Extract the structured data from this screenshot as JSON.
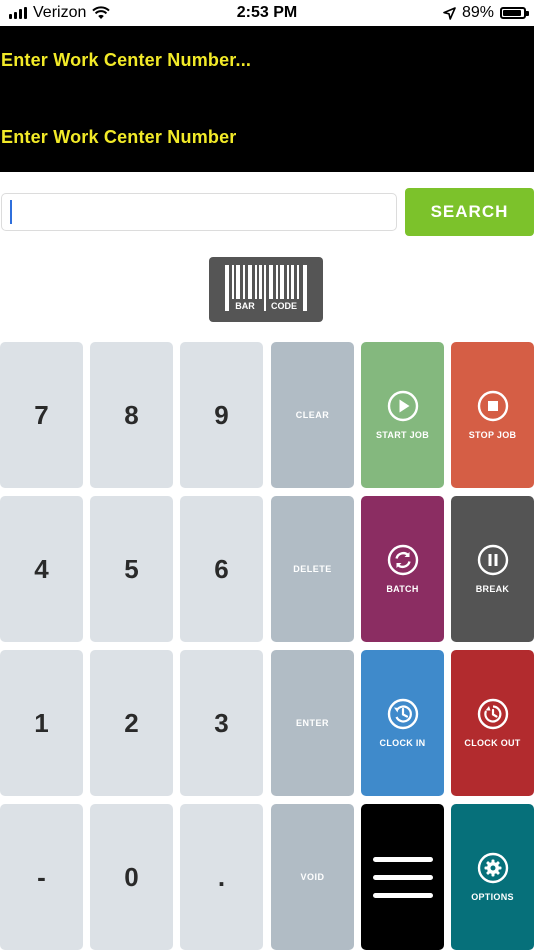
{
  "status_bar": {
    "carrier": "Verizon",
    "time": "2:53 PM",
    "battery_percent": "89%",
    "battery_level": 0.89
  },
  "header": {
    "line1": "Enter Work Center Number...",
    "line2": "Enter Work Center Number",
    "text_color": "#f2ea28",
    "background": "#000000"
  },
  "search": {
    "value": "",
    "button_label": "SEARCH",
    "button_color": "#7cc22b"
  },
  "barcode": {
    "label_left": "BAR",
    "label_right": "CODE"
  },
  "keypad": {
    "numbers": {
      "k7": "7",
      "k8": "8",
      "k9": "9",
      "k4": "4",
      "k5": "5",
      "k6": "6",
      "k1": "1",
      "k2": "2",
      "k3": "3",
      "kminus": "-",
      "k0": "0",
      "kdot": "."
    },
    "controls": {
      "clear": "CLEAR",
      "delete": "DELETE",
      "enter": "ENTER",
      "void": "VOID"
    },
    "actions": {
      "start_job": "START JOB",
      "stop_job": "STOP JOB",
      "batch": "BATCH",
      "break": "BREAK",
      "clock_in": "CLOCK IN",
      "clock_out": "CLOCK OUT",
      "options": "OPTIONS"
    },
    "colors": {
      "number": "#dce1e6",
      "control": "#b1bcc5",
      "start_job": "#84b87e",
      "stop_job": "#d55e45",
      "batch": "#8b2d62",
      "break": "#545454",
      "clock_in": "#3f8acb",
      "clock_out": "#b22b2e",
      "menu": "#000000",
      "options": "#06707a"
    }
  }
}
